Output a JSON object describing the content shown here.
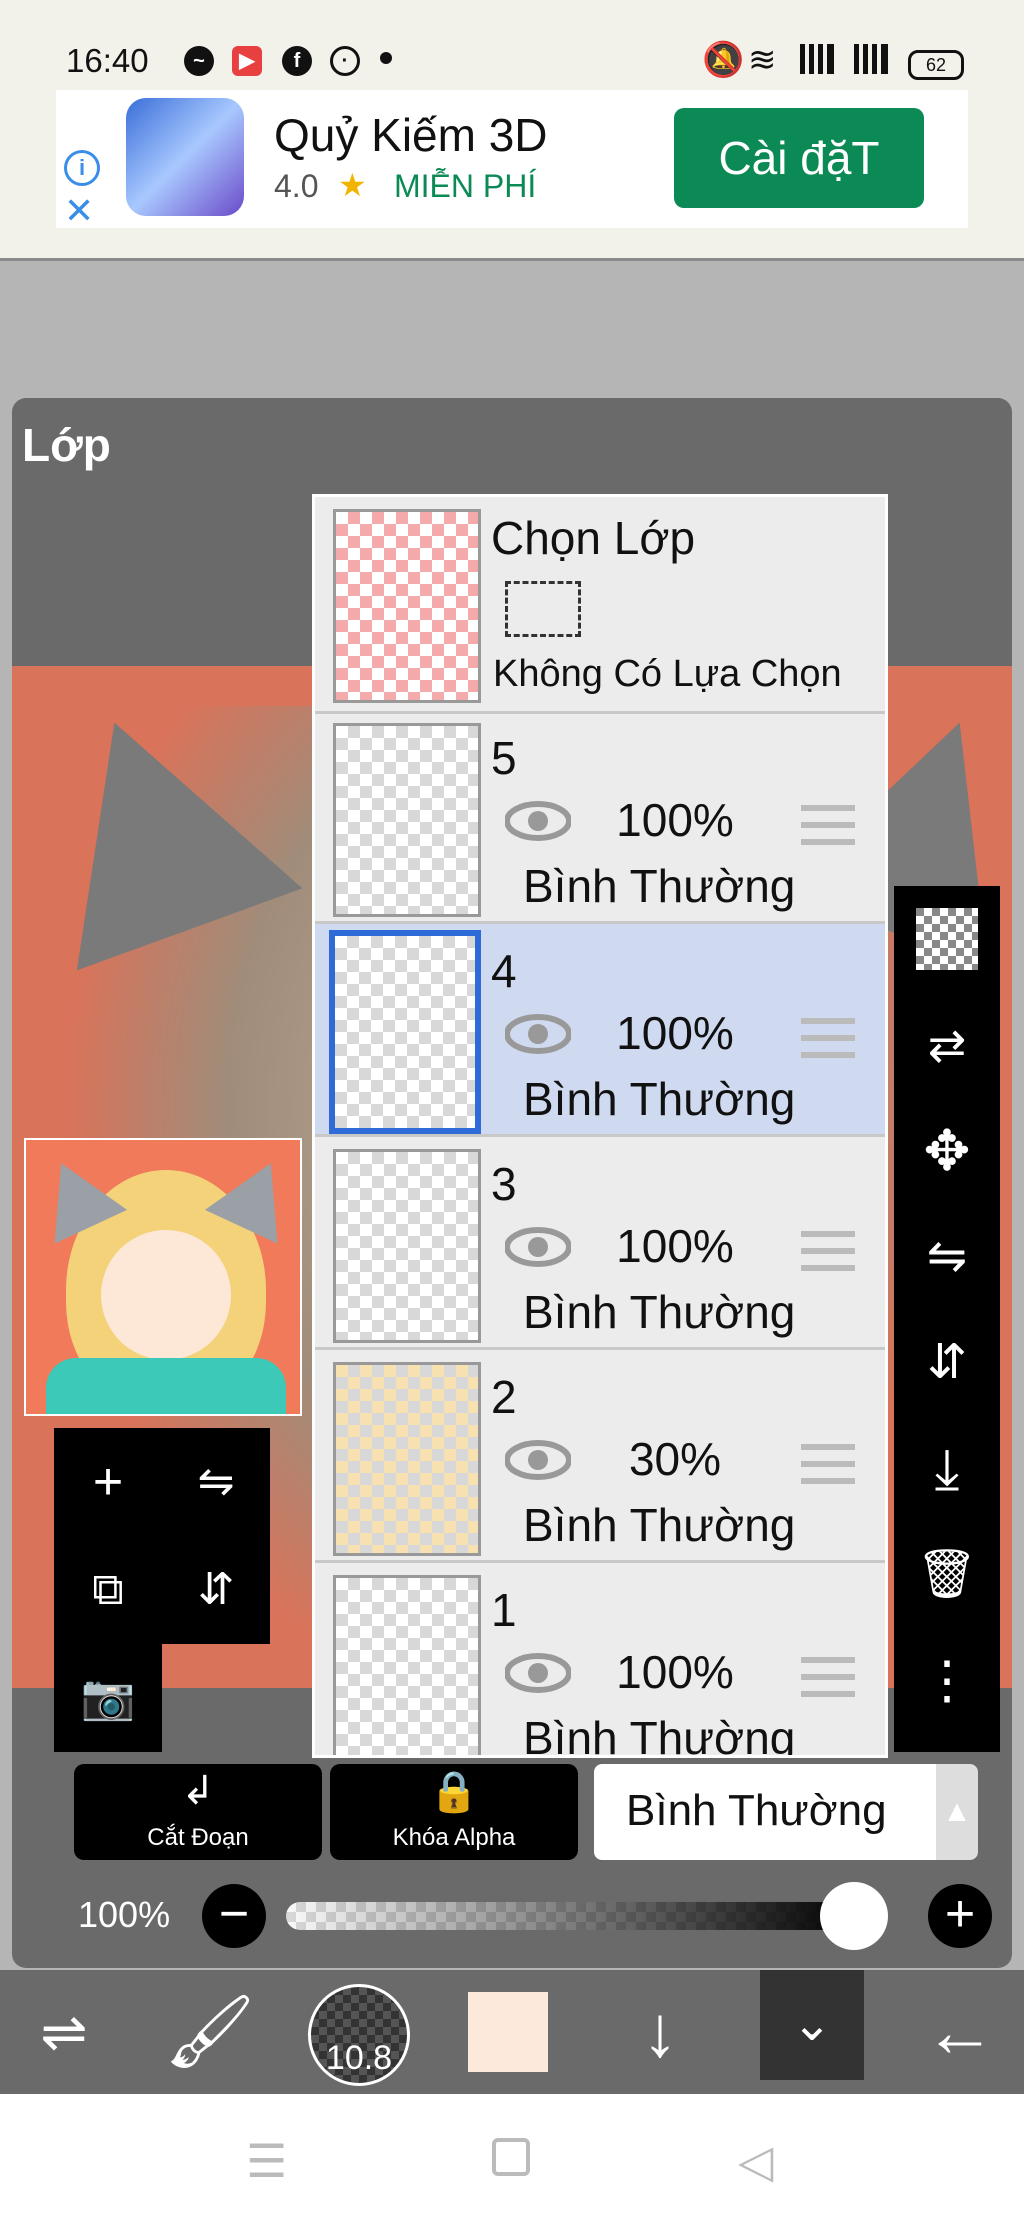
{
  "status_bar": {
    "time": "16:40",
    "battery": "62",
    "left_icons": [
      "messenger-icon",
      "video-call-icon",
      "facebook-icon",
      "settings-icon",
      "dot-icon"
    ],
    "right_icons": [
      "mute-icon",
      "wifi-icon",
      "signal-icon",
      "signal-icon"
    ]
  },
  "ad": {
    "title": "Quỷ Kiếm 3D",
    "rating": "4.0",
    "free_label": "MIỄN PHÍ",
    "install_label": "Cài đặT"
  },
  "panel": {
    "title": "Lớp"
  },
  "selection_layer": {
    "title": "Chọn Lớp",
    "status": "Không Có Lựa Chọn"
  },
  "layers": [
    {
      "number": "5",
      "opacity": "100%",
      "mode": "Bình Thường",
      "selected": false
    },
    {
      "number": "4",
      "opacity": "100%",
      "mode": "Bình Thường",
      "selected": true
    },
    {
      "number": "3",
      "opacity": "100%",
      "mode": "Bình Thường",
      "selected": false
    },
    {
      "number": "2",
      "opacity": "30%",
      "mode": "Bình Thường",
      "selected": false
    },
    {
      "number": "1",
      "opacity": "100%",
      "mode": "Bình Thường",
      "selected": false
    }
  ],
  "buttons": {
    "clipping_label": "Cắt Đoạn",
    "alpha_lock_label": "Khóa Alpha",
    "blend_mode": "Bình Thường"
  },
  "opacity": {
    "label": "100%",
    "value": 1.0
  },
  "toolbar": {
    "brush_size": "10.8",
    "color": "#fde8dc"
  },
  "colors": {
    "panel_bg": "#6a6a6a",
    "selected_row": "#cfdaf0",
    "selected_border": "#2f6bd8",
    "install_button": "#0b8a55"
  }
}
